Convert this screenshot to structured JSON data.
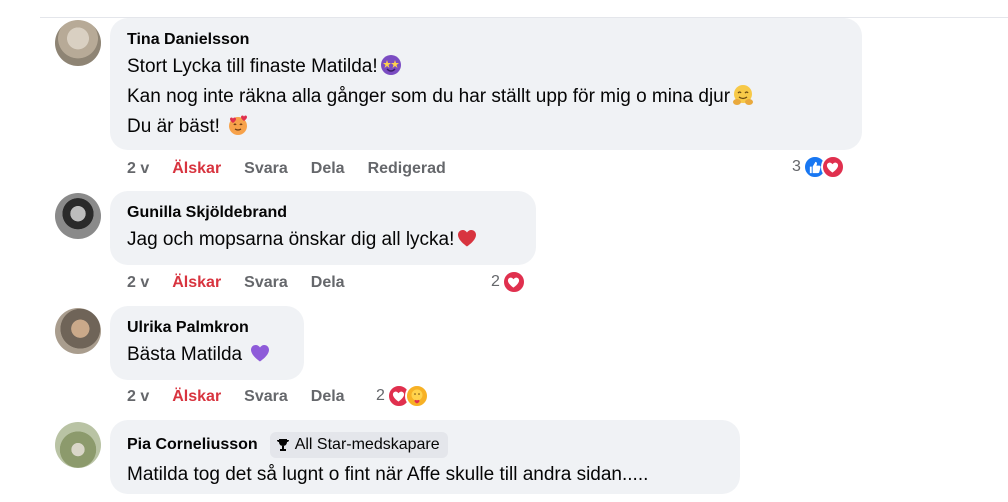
{
  "comments": [
    {
      "author": "Tina Danielsson",
      "lines": [
        "Stort Lycka till finaste Matilda!",
        "Kan nog inte räkna alla gånger som du har ställt upp för mig o mina djur",
        "Du är bäst! "
      ],
      "time": "2 v",
      "love_label": "Älskar",
      "reply_label": "Svara",
      "share_label": "Dela",
      "edited_label": "Redigerad",
      "reaction_count": "3",
      "reactions": [
        "like-icon",
        "love-icon"
      ]
    },
    {
      "author": "Gunilla Skjöldebrand",
      "lines": [
        "Jag och mopsarna önskar dig all lycka!"
      ],
      "time": "2 v",
      "love_label": "Älskar",
      "reply_label": "Svara",
      "share_label": "Dela",
      "reaction_count": "2",
      "reactions": [
        "love-icon"
      ]
    },
    {
      "author": "Ulrika Palmkron",
      "lines": [
        "Bästa Matilda "
      ],
      "time": "2 v",
      "love_label": "Älskar",
      "reply_label": "Svara",
      "share_label": "Dela",
      "reaction_count": "2",
      "reactions": [
        "love-icon",
        "care-icon"
      ]
    },
    {
      "author": "Pia Corneliusson",
      "badge": "All Star-medskapare",
      "lines": [
        "Matilda tog det så lugnt o fint när Affe skulle till andra sidan....."
      ]
    }
  ],
  "colors": {
    "bubble": "#f0f2f5",
    "love": "#d8343f",
    "like": "#1877f2",
    "secondary": "#65676b"
  }
}
